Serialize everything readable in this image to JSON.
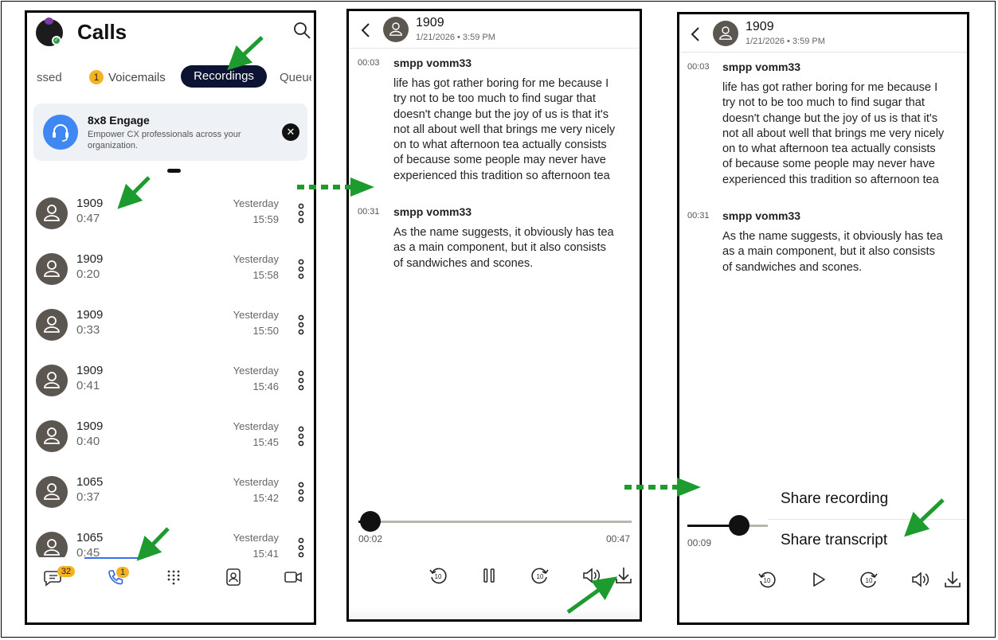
{
  "calls_screen": {
    "title": "Calls",
    "tabs": [
      {
        "label": "ssed"
      },
      {
        "label": "Voicemails",
        "badge": "1"
      },
      {
        "label": "Recordings",
        "selected": true
      },
      {
        "label": "Queue"
      }
    ],
    "promo": {
      "title": "8x8 Engage",
      "description": "Empower CX professionals across your organization."
    },
    "calls": [
      {
        "name": "1909",
        "duration": "0:47",
        "day": "Yesterday",
        "time": "15:59"
      },
      {
        "name": "1909",
        "duration": "0:20",
        "day": "Yesterday",
        "time": "15:58"
      },
      {
        "name": "1909",
        "duration": "0:33",
        "day": "Yesterday",
        "time": "15:50"
      },
      {
        "name": "1909",
        "duration": "0:41",
        "day": "Yesterday",
        "time": "15:46"
      },
      {
        "name": "1909",
        "duration": "0:40",
        "day": "Yesterday",
        "time": "15:45"
      },
      {
        "name": "1065",
        "duration": "0:37",
        "day": "Yesterday",
        "time": "15:42"
      },
      {
        "name": "1065",
        "duration": "0:45",
        "day": "Yesterday",
        "time": "15:41"
      }
    ],
    "bottom_nav": {
      "messages_badge": "32",
      "calls_badge": "1",
      "items": [
        "chat-icon",
        "phone-icon",
        "dialpad-icon",
        "contacts-icon",
        "video-icon"
      ]
    }
  },
  "player_playing": {
    "contact": "1909",
    "date": "1/21/2026 • 3:59 PM",
    "transcript": [
      {
        "time": "00:03",
        "speaker": "smpp  vomm33",
        "text": "life has got rather boring for me because I\ntry not to be too much to find sugar that\ndoesn't change but the joy of us is that it's\nnot all about well that brings me very nicely\non to what afternoon tea actually consists\nof because some people may never have\nexperienced this tradition so afternoon tea"
      },
      {
        "time": "00:31",
        "speaker": "smpp  vomm33",
        "text": "As the name suggests, it obviously has tea\nas a main component, but it also consists\nof sandwiches and scones."
      }
    ],
    "elapsed": "00:02",
    "total": "00:47",
    "progress": 0.043,
    "state": "playing"
  },
  "player_share": {
    "contact": "1909",
    "date": "1/21/2026 • 3:59 PM",
    "elapsed": "00:09",
    "progress": 0.19,
    "state": "paused",
    "share_menu": {
      "share_recording": "Share recording",
      "share_transcript": "Share transcript"
    }
  },
  "colors": {
    "accent_dark": "#0b1533",
    "badge_yellow": "#f5b324",
    "annotation_green": "#1e9b2e",
    "avatar_gray": "#5b5650",
    "engage_blue": "#3f87f2"
  }
}
